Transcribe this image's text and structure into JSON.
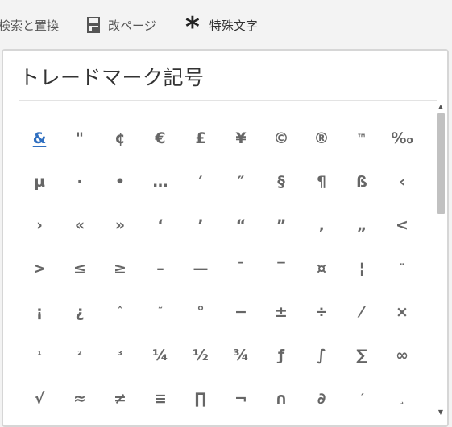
{
  "toolbar": {
    "find_replace": "検索と置換",
    "page_break": "改ページ",
    "special_chars": "特殊文字",
    "special_icon": "*"
  },
  "panel": {
    "title": "トレードマーク記号"
  },
  "symbols": [
    "&",
    "\"",
    "¢",
    "€",
    "£",
    "¥",
    "©",
    "®",
    "™",
    "‰",
    "µ",
    "·",
    "•",
    "…",
    "′",
    "″",
    "§",
    "¶",
    "ß",
    "‹",
    "›",
    "«",
    "»",
    "‘",
    "’",
    "“",
    "”",
    "‚",
    "„",
    "<",
    ">",
    "≤",
    "≥",
    "–",
    "—",
    "¯",
    "‾",
    "¤",
    "¦",
    "¨",
    "¡",
    "¿",
    "ˆ",
    "˜",
    "°",
    "−",
    "±",
    "÷",
    "⁄",
    "×",
    "¹",
    "²",
    "³",
    "¼",
    "½",
    "¾",
    "ƒ",
    "∫",
    "∑",
    "∞",
    "√",
    "≈",
    "≠",
    "≡",
    "∏",
    "¬",
    "∩",
    "∂",
    "´",
    "¸"
  ],
  "selected_index": 0
}
